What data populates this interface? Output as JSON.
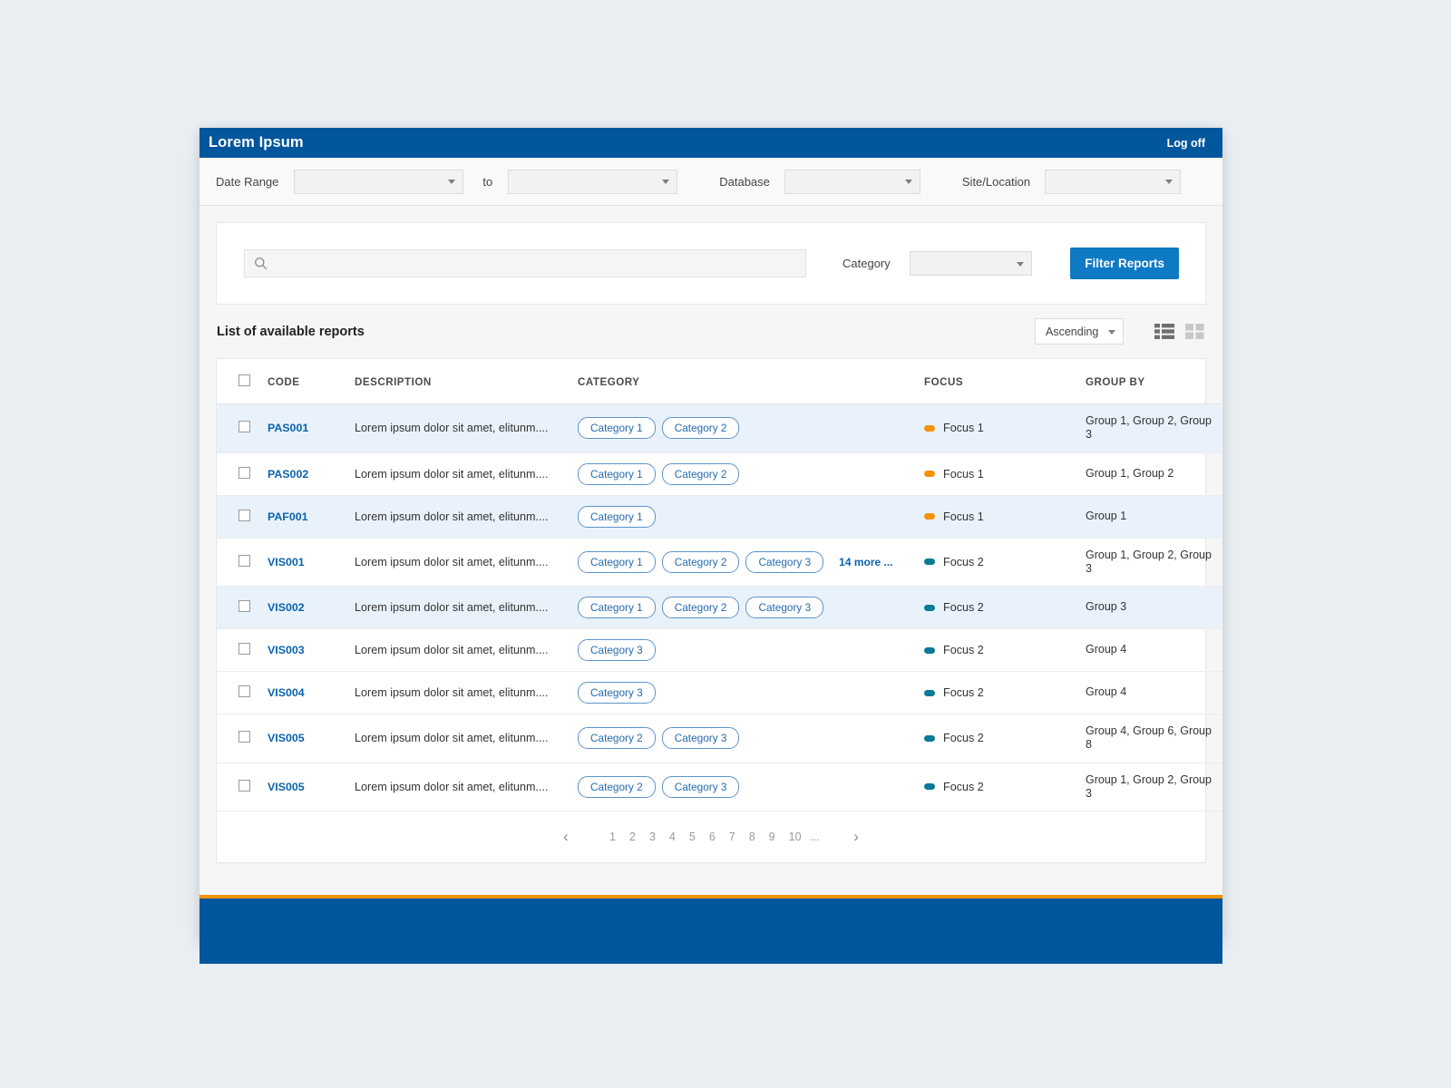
{
  "titlebar": {
    "title": "Lorem Ipsum",
    "logoff": "Log off"
  },
  "filterbar": {
    "date_range_label": "Date Range",
    "date_from_value": "",
    "to_label": "to",
    "date_to_value": "",
    "database_label": "Database",
    "database_value": "",
    "site_label": "Site/Location",
    "site_value": ""
  },
  "search": {
    "placeholder": "",
    "value": "",
    "category_label": "Category",
    "category_value": "",
    "filter_button": "Filter Reports"
  },
  "list": {
    "title": "List of available reports",
    "sort_value": "Ascending",
    "view_list_icon": "list-view-icon",
    "view_grid_icon": "grid-view-icon"
  },
  "table": {
    "columns": [
      "CODE",
      "DESCRIPTION",
      "CATEGORY",
      "FOCUS",
      "GROUP BY"
    ],
    "rows": [
      {
        "code": "PAS001",
        "description": "Lorem ipsum dolor sit amet, elitunm....",
        "categories": [
          "Category 1",
          "Category 2"
        ],
        "more": "",
        "focus": "Focus 1",
        "focus_color": "#f5920a",
        "group_by": "Group 1, Group 2, Group 3"
      },
      {
        "code": "PAS002",
        "description": "Lorem ipsum dolor sit amet, elitunm....",
        "categories": [
          "Category 1",
          "Category 2"
        ],
        "more": "",
        "focus": "Focus 1",
        "focus_color": "#f5920a",
        "group_by": "Group 1, Group 2"
      },
      {
        "code": "PAF001",
        "description": "Lorem ipsum dolor sit amet, elitunm....",
        "categories": [
          "Category 1"
        ],
        "more": "",
        "focus": "Focus 1",
        "focus_color": "#f5920a",
        "group_by": "Group 1"
      },
      {
        "code": "VIS001",
        "description": "Lorem ipsum dolor sit amet, elitunm....",
        "categories": [
          "Category 1",
          "Category 2",
          "Category 3"
        ],
        "more": "14 more ...",
        "focus": "Focus 2",
        "focus_color": "#0a7b96",
        "group_by": "Group 1, Group 2, Group 3"
      },
      {
        "code": "VIS002",
        "description": "Lorem ipsum dolor sit amet, elitunm....",
        "categories": [
          "Category 1",
          "Category 2",
          "Category 3"
        ],
        "more": "",
        "focus": "Focus 2",
        "focus_color": "#0a7b96",
        "group_by": "Group 3"
      },
      {
        "code": "VIS003",
        "description": "Lorem ipsum dolor sit amet, elitunm....",
        "categories": [
          "Category 3"
        ],
        "more": "",
        "focus": "Focus 2",
        "focus_color": "#0a7b96",
        "group_by": "Group 4"
      },
      {
        "code": "VIS004",
        "description": "Lorem ipsum dolor sit amet, elitunm....",
        "categories": [
          "Category 3"
        ],
        "more": "",
        "focus": "Focus 2",
        "focus_color": "#0a7b96",
        "group_by": "Group 4"
      },
      {
        "code": "VIS005",
        "description": "Lorem ipsum dolor sit amet, elitunm....",
        "categories": [
          "Category 2",
          "Category 3"
        ],
        "more": "",
        "focus": "Focus 2",
        "focus_color": "#0a7b96",
        "group_by": "Group 4, Group 6, Group 8"
      },
      {
        "code": "VIS005",
        "description": "Lorem ipsum dolor sit amet, elitunm....",
        "categories": [
          "Category 2",
          "Category 3"
        ],
        "more": "",
        "focus": "Focus 2",
        "focus_color": "#0a7b96",
        "group_by": "Group 1, Group 2, Group 3"
      }
    ]
  },
  "pagination": {
    "prev": "‹",
    "next": "›",
    "pages": [
      "1",
      "2",
      "3",
      "4",
      "5",
      "6",
      "7",
      "8",
      "9",
      "10"
    ],
    "ellipsis": "..."
  },
  "colors": {
    "brand_blue": "#02569c",
    "accent_orange": "#f29200",
    "button_blue": "#0f7ac4",
    "focus1": "#f5920a",
    "focus2": "#0a7b96",
    "row_highlight": "#e9f2fb"
  }
}
